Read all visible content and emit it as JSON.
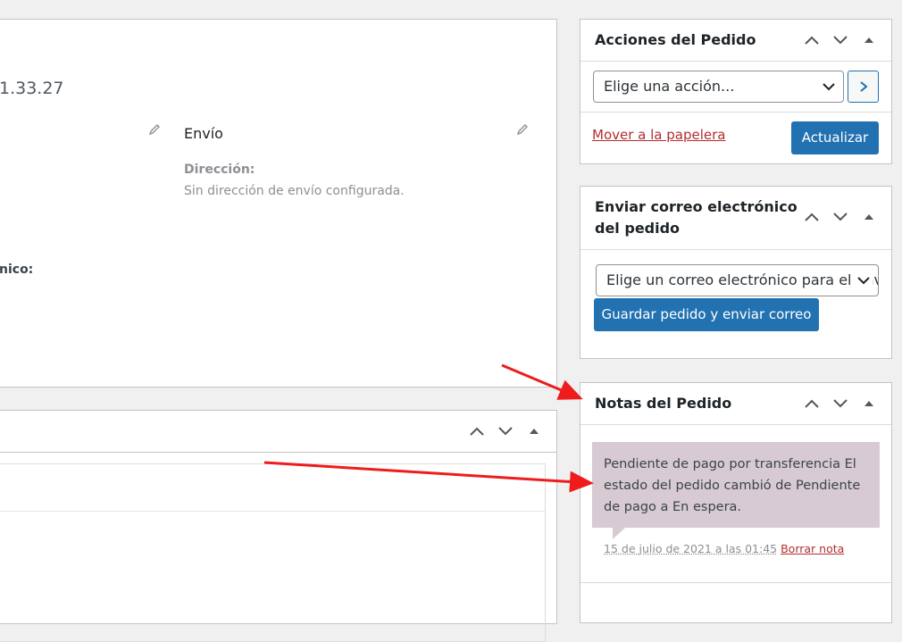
{
  "main": {
    "order_number_fragment": "1.33.27",
    "shipping": {
      "title": "Envío",
      "address_label": "Dirección:",
      "address_value": "Sin dirección de envío configurada."
    },
    "billing": {
      "email_label_fragment": "nico:"
    }
  },
  "sidebar": {
    "order_actions": {
      "title": "Acciones del Pedido",
      "select_value": "Elige una acción...",
      "trash_link": "Mover a la papelera",
      "update_button": "Actualizar"
    },
    "email_order": {
      "title_line1": "Enviar correo electrónico",
      "title_line2": "del pedido",
      "select_value": "Elige un correo electrónico para el envío...",
      "save_button": "Guardar pedido y enviar correo"
    },
    "order_notes": {
      "title": "Notas del Pedido",
      "note_text": "Pendiente de pago por transferencia El estado del pedido cambió de Pendiente de pago a En espera.",
      "note_date": "15 de julio de 2021 a las 01:45",
      "delete_link": "Borrar nota"
    }
  },
  "colors": {
    "primary": "#2271b1",
    "danger_link": "#b32d2e",
    "note_background": "#d7cad2",
    "annotation_arrow": "#ee1c1c"
  }
}
